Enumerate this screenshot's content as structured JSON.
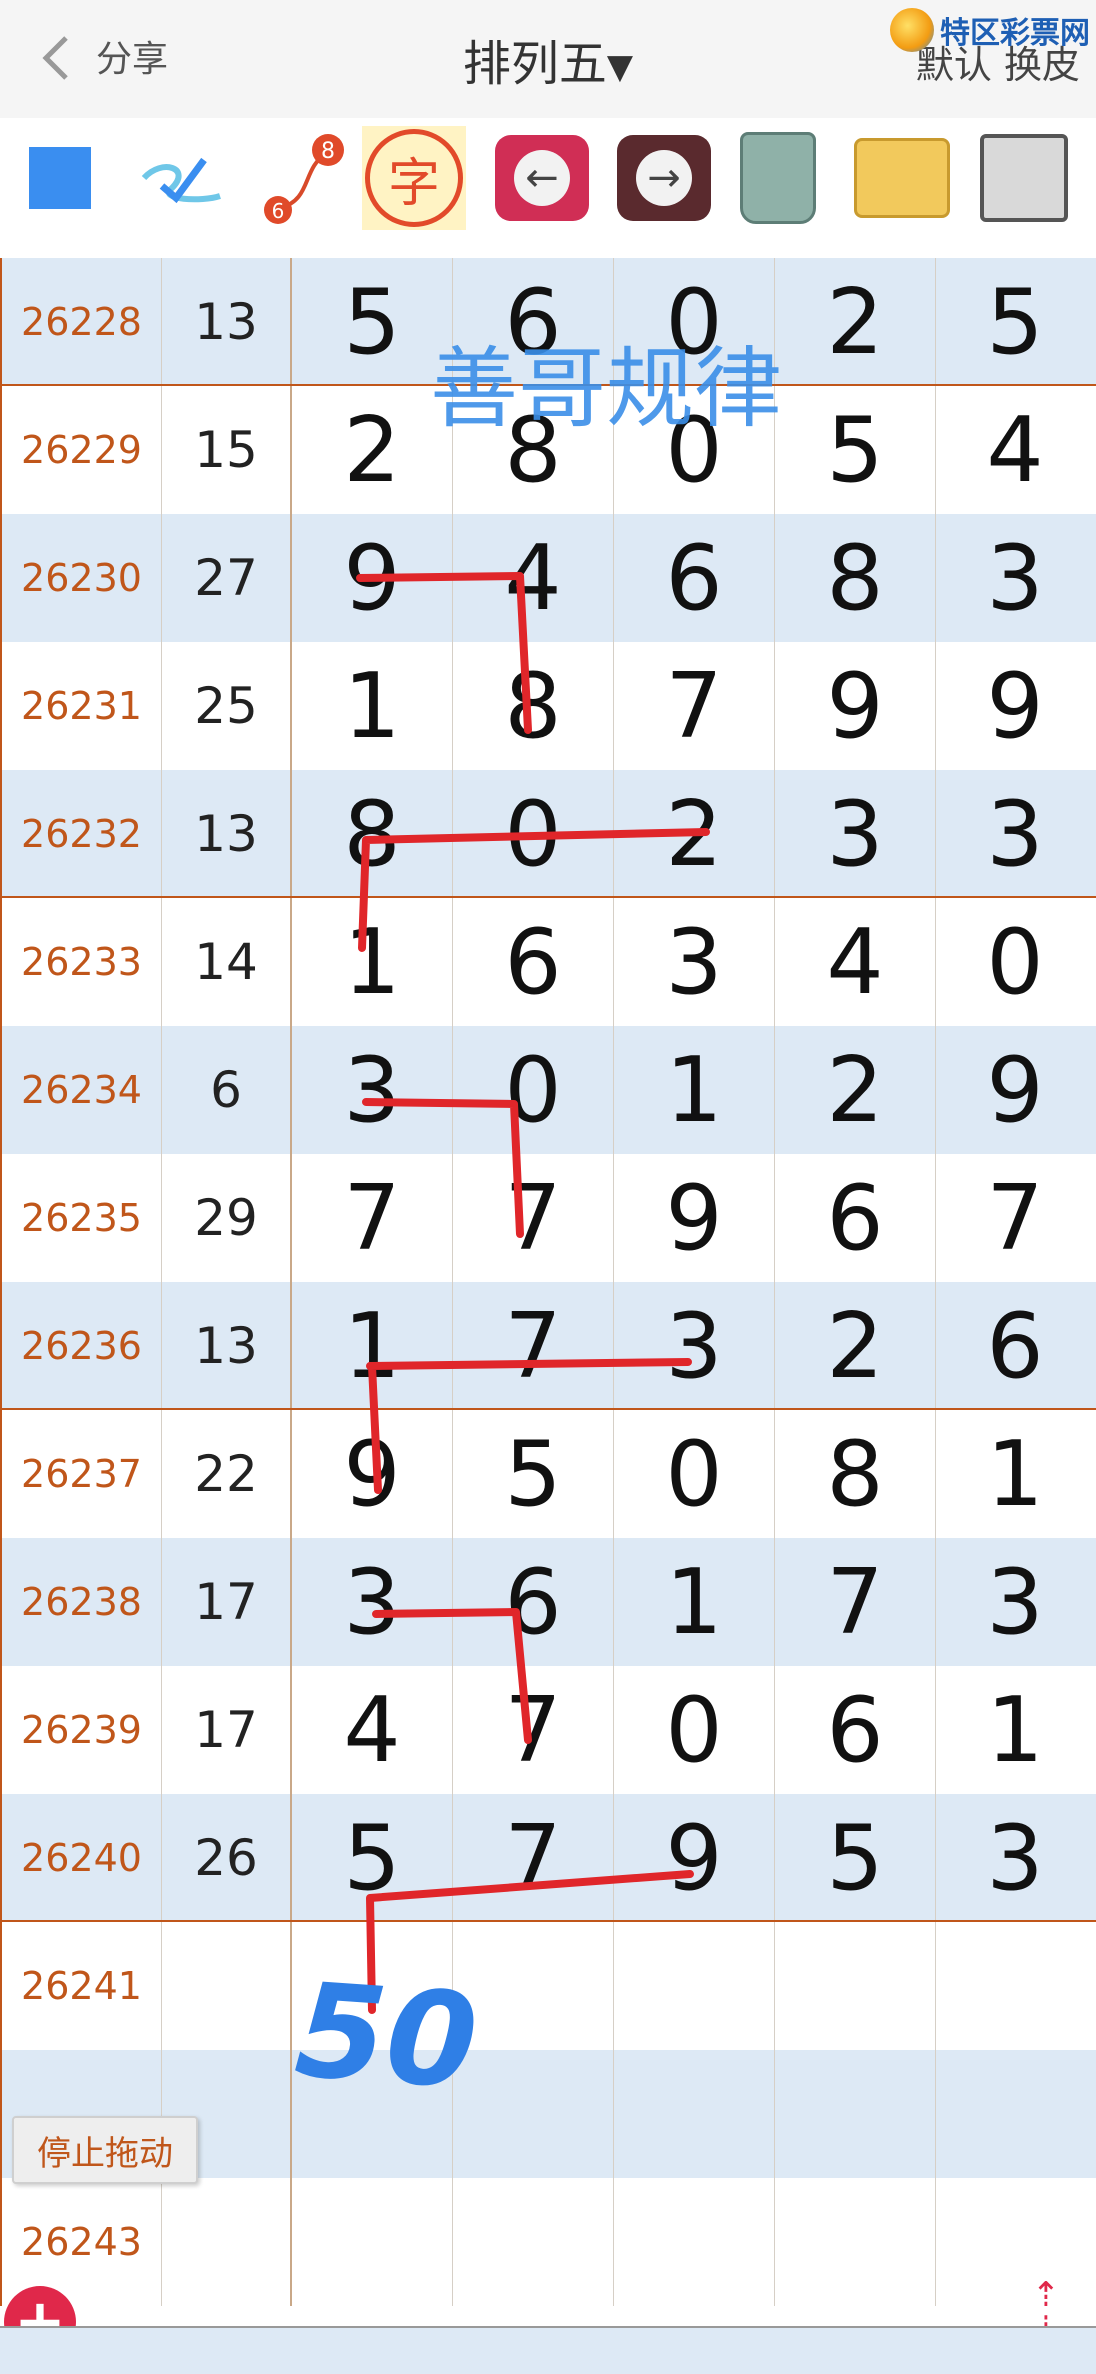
{
  "header": {
    "share_label": "分享",
    "title": "排列五",
    "skin_label": "默认 换皮",
    "logo_text": "特区彩票网"
  },
  "toolbar": {
    "tools": [
      {
        "name": "color-square",
        "icon": "blue-square"
      },
      {
        "name": "pen",
        "icon": "pen-check-icon"
      },
      {
        "name": "link",
        "icon": "link-icon",
        "labels": [
          "8",
          "6"
        ]
      },
      {
        "name": "char",
        "icon": "char-icon",
        "label": "字"
      },
      {
        "name": "prev",
        "icon": "arrow-left-icon"
      },
      {
        "name": "next",
        "icon": "arrow-right-icon"
      },
      {
        "name": "trash",
        "icon": "trash-icon"
      },
      {
        "name": "folder",
        "icon": "folder-icon"
      },
      {
        "name": "save",
        "icon": "floppy-disk-icon"
      }
    ]
  },
  "watermark": "善哥规律",
  "handwriting": "50",
  "rows": [
    {
      "issue": "26228",
      "sum": "13",
      "d": [
        "5",
        "6",
        "0",
        "2",
        "5"
      ]
    },
    {
      "issue": "26229",
      "sum": "15",
      "d": [
        "2",
        "8",
        "0",
        "5",
        "4"
      ]
    },
    {
      "issue": "26230",
      "sum": "27",
      "d": [
        "9",
        "4",
        "6",
        "8",
        "3"
      ]
    },
    {
      "issue": "26231",
      "sum": "25",
      "d": [
        "1",
        "8",
        "7",
        "9",
        "9"
      ]
    },
    {
      "issue": "26232",
      "sum": "13",
      "d": [
        "8",
        "0",
        "2",
        "3",
        "3"
      ]
    },
    {
      "issue": "26233",
      "sum": "14",
      "d": [
        "1",
        "6",
        "3",
        "4",
        "0"
      ]
    },
    {
      "issue": "26234",
      "sum": "6",
      "d": [
        "3",
        "0",
        "1",
        "2",
        "9"
      ]
    },
    {
      "issue": "26235",
      "sum": "29",
      "d": [
        "7",
        "7",
        "9",
        "6",
        "7"
      ]
    },
    {
      "issue": "26236",
      "sum": "13",
      "d": [
        "1",
        "7",
        "3",
        "2",
        "6"
      ]
    },
    {
      "issue": "26237",
      "sum": "22",
      "d": [
        "9",
        "5",
        "0",
        "8",
        "1"
      ]
    },
    {
      "issue": "26238",
      "sum": "17",
      "d": [
        "3",
        "6",
        "1",
        "7",
        "3"
      ]
    },
    {
      "issue": "26239",
      "sum": "17",
      "d": [
        "4",
        "7",
        "0",
        "6",
        "1"
      ]
    },
    {
      "issue": "26240",
      "sum": "26",
      "d": [
        "5",
        "7",
        "9",
        "5",
        "3"
      ]
    },
    {
      "issue": "26241",
      "sum": "",
      "d": [
        "",
        "",
        "",
        "",
        ""
      ]
    },
    {
      "issue": "",
      "sum": "",
      "d": [
        "",
        "",
        "",
        "",
        ""
      ]
    },
    {
      "issue": "26243",
      "sum": "",
      "d": [
        "",
        "",
        "",
        "",
        ""
      ]
    }
  ],
  "stop_drag_label": "停止拖动",
  "plus_icon": "plus-icon",
  "scroll_icon": "scroll-updown-icon"
}
